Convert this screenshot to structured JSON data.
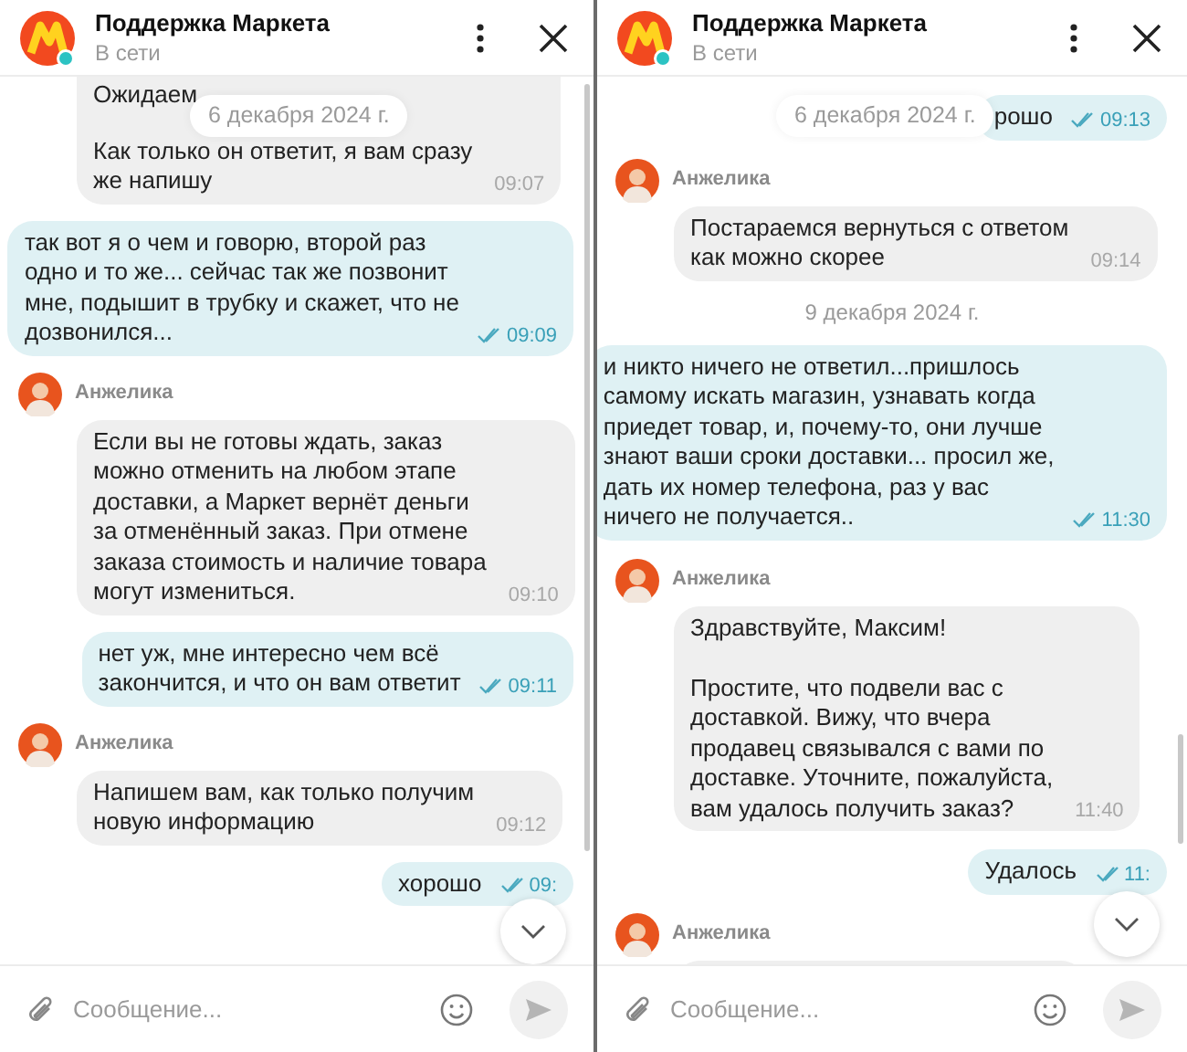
{
  "panels": [
    {
      "header": {
        "title": "Поддержка Маркета",
        "status": "В сети"
      },
      "date_pill": "6 декабря 2024 г.",
      "messages": [
        {
          "kind": "incoming",
          "cut_top": true,
          "partial_line": "Ожидаем",
          "text": "Как только он ответит, я вам сразу\nже напишу",
          "time": "09:07"
        },
        {
          "kind": "outgoing",
          "text": "так вот я о чем и говорю, второй раз\nодно и то же... сейчас так же позвонит\nмне, подышит в трубку и скажет, что не\nдозвонился...",
          "time": "09:09",
          "read": true
        },
        {
          "kind": "author",
          "name": "Анжелика"
        },
        {
          "kind": "incoming",
          "cut_top": false,
          "text": "Если вы не готовы ждать, заказ\nможно отменить на любом этапе\nдоставки, а Маркет вернёт деньги\nза отменённый заказ. При отмене\nзаказа стоимость и наличие товара\nмогут измениться.",
          "time": "09:10"
        },
        {
          "kind": "outgoing",
          "text": "нет уж, мне интересно чем всё\nзакончится, и что он вам ответит",
          "time": "09:11",
          "read": true
        },
        {
          "kind": "author",
          "name": "Анжелика"
        },
        {
          "kind": "incoming",
          "cut_top": false,
          "text": "Напишем вам, как только получим\nновую информацию",
          "time": "09:12"
        },
        {
          "kind": "outgoing",
          "text": "хорошо",
          "time": "09:",
          "read": true
        }
      ],
      "composer": {
        "placeholder": "Сообщение..."
      }
    },
    {
      "header": {
        "title": "Поддержка Маркета",
        "status": "В сети"
      },
      "date_pill": "6 декабря 2024 г.",
      "messages": [
        {
          "kind": "outgoing",
          "text": "рошо",
          "time": "09:13",
          "read": true
        },
        {
          "kind": "author",
          "name": "Анжелика"
        },
        {
          "kind": "incoming",
          "cut_top": false,
          "text": "Постараемся вернуться с ответом\nкак можно скорее",
          "time": "09:14"
        },
        {
          "kind": "date",
          "text": "9 декабря 2024 г."
        },
        {
          "kind": "outgoing",
          "text": "и никто ничего не ответил...пришлось\nсамому искать магазин, узнавать когда\nприедет товар, и, почему-то, они лучше\nзнают ваши сроки доставки... просил же,\nдать их номер телефона, раз у вас\nничего не получается..",
          "time": "11:30",
          "read": true
        },
        {
          "kind": "author",
          "name": "Анжелика"
        },
        {
          "kind": "incoming",
          "cut_top": false,
          "text": "Здравствуйте, Максим!\n\nПростите, что подвели вас с\nдоставкой. Вижу, что вчера\nпродавец связывался с вами по\nдоставке. Уточните, пожалуйста,\nвам удалось получить заказ?",
          "time": "11:40"
        },
        {
          "kind": "outgoing",
          "text": "Удалось",
          "time": "11:",
          "read": true
        },
        {
          "kind": "author",
          "name": "Анжелика"
        },
        {
          "kind": "cut"
        }
      ],
      "composer": {
        "placeholder": "Сообщение..."
      }
    }
  ]
}
